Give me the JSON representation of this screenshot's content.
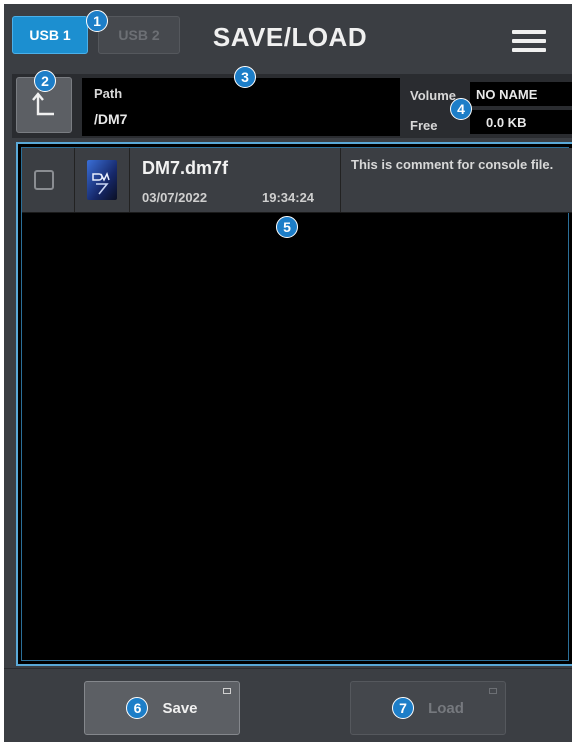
{
  "header": {
    "usb1_label": "USB 1",
    "usb2_label": "USB 2",
    "title": "SAVE/LOAD",
    "menu_icon": "hamburger-menu-icon"
  },
  "path_bar": {
    "up_icon": "up-arrow-icon",
    "path_label": "Path",
    "path_value": "/DM7",
    "volume_label": "Volume",
    "volume_value": "NO NAME",
    "free_label": "Free",
    "free_value": "0.0 KB"
  },
  "files": [
    {
      "checked": false,
      "icon": "dm7-file-icon",
      "name": "DM7.dm7f",
      "date": "03/07/2022",
      "time": "19:34:24",
      "comment": "This is comment for console file."
    }
  ],
  "actions": {
    "save_label": "Save",
    "load_label": "Load"
  },
  "callouts": [
    "1",
    "2",
    "3",
    "4",
    "5",
    "6",
    "7"
  ],
  "colors": {
    "accent": "#1c8fd0",
    "callout": "#1d7ec8",
    "panel": "#3b3e43"
  }
}
